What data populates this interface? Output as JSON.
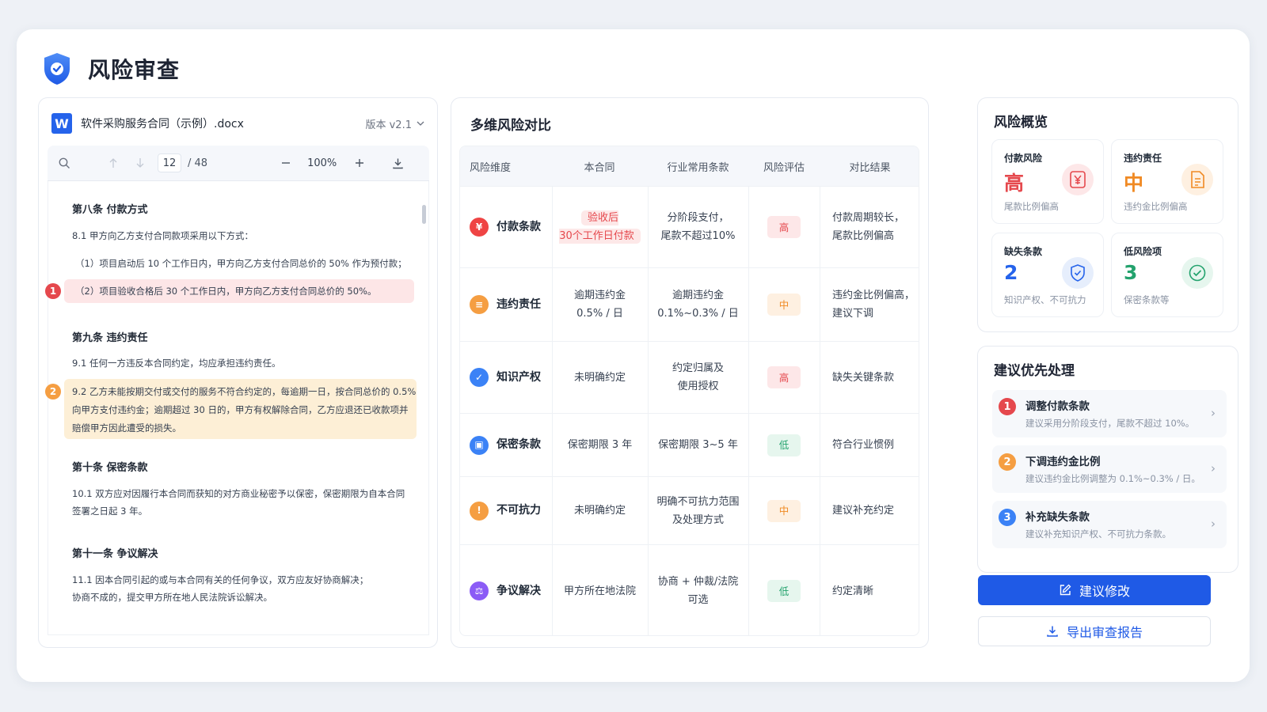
{
  "app": {
    "title": "风险审查"
  },
  "document": {
    "filename": "软件采购服务合同（示例）.docx",
    "version": "版本 v2.1",
    "page_current": "12",
    "page_total": "/ 48",
    "zoom": "100%",
    "sections": [
      {
        "title": "第八条  付款方式",
        "paras": [
          "8.1 甲方向乙方支付合同款项采用以下方式：",
          "（1）项目启动后 10 个工作日内，甲方向乙方支付合同总价的 50% 作为预付款；",
          "（2）项目验收合格后 30 个工作日内，甲方向乙方支付合同总价的 50%。"
        ]
      },
      {
        "title": "第九条  违约责任",
        "paras": [
          "9.1 任何一方违反本合同约定，均应承担违约责任。",
          "9.2 乙方未能按期交付或交付的服务不符合约定的，每逾期一日，按合同总价的 0.5%",
          "向甲方支付违约金；逾期超过 30 日的，甲方有权解除合同，乙方应退还已收款项并",
          "赔偿甲方因此遭受的损失。"
        ]
      },
      {
        "title": "第十条  保密条款",
        "paras": [
          "10.1 双方应对因履行本合同而获知的对方商业秘密予以保密，保密期限为自本合同",
          "签署之日起  3  年。"
        ]
      },
      {
        "title": "第十一条  争议解决",
        "paras": [
          "11.1 因本合同引起的或与本合同有关的任何争议，双方应友好协商解决；",
          "协商不成的，提交甲方所在地人民法院诉讼解决。"
        ]
      }
    ],
    "markers": [
      "1",
      "2"
    ]
  },
  "comparison": {
    "title": "多维风险对比",
    "headers": [
      "风险维度",
      "本合同",
      "行业常用条款",
      "风险评估",
      "对比结果"
    ],
    "rows": [
      {
        "dimension": "付款条款",
        "icon": "yen-icon",
        "icon_glyph": "¥",
        "color": "#ef4444",
        "ours_line1": "验收后",
        "ours_line2": "30个工作日付款",
        "industry_line1": "分阶段支付，",
        "industry_line2": "尾款不超过10%",
        "risk": "高",
        "risk_level": "high",
        "result_line1": "付款周期较长，",
        "result_line2": "尾款比例偏高"
      },
      {
        "dimension": "违约责任",
        "icon": "document-icon",
        "icon_glyph": "≡",
        "color": "#f59e42",
        "ours_line1": "逾期违约金",
        "ours_line2": "0.5% / 日",
        "industry_line1": "逾期违约金",
        "industry_line2": "0.1%~0.3% / 日",
        "risk": "中",
        "risk_level": "medium",
        "result_line1": "违约金比例偏高，",
        "result_line2": "建议下调"
      },
      {
        "dimension": "知识产权",
        "icon": "shield-check-icon",
        "icon_glyph": "✓",
        "color": "#3b82f6",
        "ours_line1": "未明确约定",
        "ours_line2": "",
        "industry_line1": "约定归属及",
        "industry_line2": "使用授权",
        "risk": "高",
        "risk_level": "high",
        "result_line1": "缺失关键条款",
        "result_line2": ""
      },
      {
        "dimension": "保密条款",
        "icon": "lock-icon",
        "icon_glyph": "▣",
        "color": "#3b82f6",
        "ours_line1": "保密期限 3 年",
        "ours_line2": "",
        "industry_line1": "保密期限 3~5 年",
        "industry_line2": "",
        "risk": "低",
        "risk_level": "low",
        "result_line1": "符合行业惯例",
        "result_line2": ""
      },
      {
        "dimension": "不可抗力",
        "icon": "exclamation-icon",
        "icon_glyph": "!",
        "color": "#f59e42",
        "ours_line1": "未明确约定",
        "ours_line2": "",
        "industry_line1": "明确不可抗力范围",
        "industry_line2": "及处理方式",
        "risk": "中",
        "risk_level": "medium",
        "result_line1": "建议补充约定",
        "result_line2": ""
      },
      {
        "dimension": "争议解决",
        "icon": "scale-icon",
        "icon_glyph": "⚖",
        "color": "#8b5cf6",
        "ours_line1": "甲方所在地法院",
        "ours_line2": "",
        "industry_line1": "协商 + 仲裁/法院",
        "industry_line2": "可选",
        "risk": "低",
        "risk_level": "low",
        "result_line1": "约定清晰",
        "result_line2": ""
      }
    ]
  },
  "overview": {
    "title": "风险概览",
    "stats": [
      {
        "label": "付款风险",
        "value": "高",
        "sub": "尾款比例偏高",
        "color": "#e5484d",
        "icon": "yen-document-icon"
      },
      {
        "label": "违约责任",
        "value": "中",
        "sub": "违约金比例偏高",
        "color": "#f08a24",
        "icon": "document-icon"
      },
      {
        "label": "缺失条款",
        "value": "2",
        "sub": "知识产权、不可抗力",
        "color": "#2563eb",
        "icon": "shield-check-icon"
      },
      {
        "label": "低风险项",
        "value": "3",
        "sub": "保密条款等",
        "color": "#23a26d",
        "icon": "check-circle-icon"
      }
    ]
  },
  "suggestions": {
    "title": "建议优先处理",
    "items": [
      {
        "num": "1",
        "title": "调整付款条款",
        "desc": "建议采用分阶段支付，尾款不超过 10%。",
        "color": "#e5484d"
      },
      {
        "num": "2",
        "title": "下调违约金比例",
        "desc": "建议违约金比例调整为 0.1%~0.3% / 日。",
        "color": "#f59e42"
      },
      {
        "num": "3",
        "title": "补充缺失条款",
        "desc": "建议补充知识产权、不可抗力条款。",
        "color": "#3b82f6"
      }
    ]
  },
  "actions": {
    "primary": "建议修改",
    "secondary": "导出审查报告"
  }
}
